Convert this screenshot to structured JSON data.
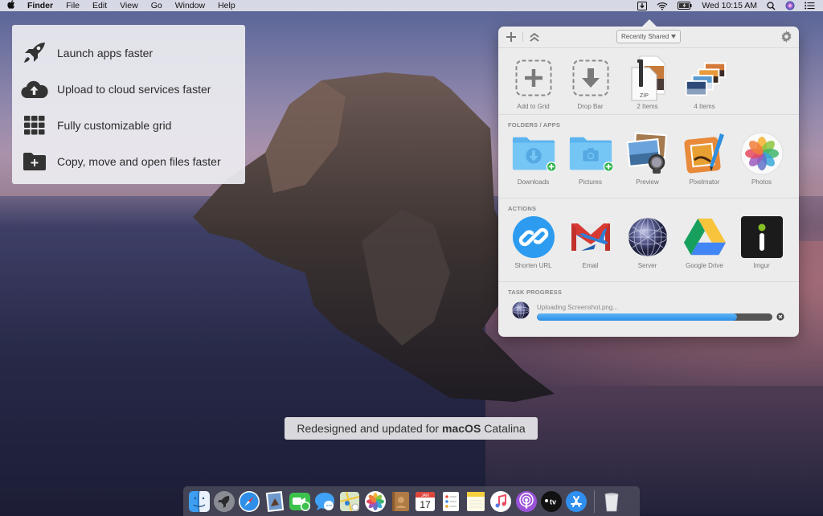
{
  "menubar": {
    "app_name": "Finder",
    "menus": [
      "File",
      "Edit",
      "View",
      "Go",
      "Window",
      "Help"
    ],
    "status_icons": [
      "dropzone-icon",
      "wifi-icon",
      "battery-icon"
    ],
    "clock": "Wed 10:15 AM",
    "extra_icons": [
      "spotlight-icon",
      "siri-icon",
      "notification-center-icon"
    ]
  },
  "features": [
    {
      "icon": "rocket-icon",
      "text": "Launch apps faster"
    },
    {
      "icon": "cloud-upload-icon",
      "text": "Upload to cloud services faster"
    },
    {
      "icon": "grid-icon",
      "text": "Fully customizable grid"
    },
    {
      "icon": "folder-plus-icon",
      "text": "Copy, move and open files faster"
    }
  ],
  "popover": {
    "dropdown_label": "Recently Shared",
    "top_items": [
      {
        "label": "Add to Grid",
        "icon": "add-to-grid-icon"
      },
      {
        "label": "Drop Bar",
        "icon": "drop-bar-icon"
      },
      {
        "label": "2 Items",
        "icon": "zip-stack-icon"
      },
      {
        "label": "4 Items",
        "icon": "photo-stack-icon"
      }
    ],
    "folders_title": "FOLDERS / APPS",
    "folders": [
      {
        "label": "Downloads",
        "icon": "downloads-folder-icon"
      },
      {
        "label": "Pictures",
        "icon": "pictures-folder-icon"
      },
      {
        "label": "Preview",
        "icon": "preview-app-icon"
      },
      {
        "label": "Pixelmator",
        "icon": "pixelmator-app-icon"
      },
      {
        "label": "Photos",
        "icon": "photos-app-icon"
      }
    ],
    "actions_title": "ACTIONS",
    "actions": [
      {
        "label": "Shorten URL",
        "icon": "link-icon"
      },
      {
        "label": "Email",
        "icon": "email-icon"
      },
      {
        "label": "Server",
        "icon": "server-globe-icon"
      },
      {
        "label": "Google Drive",
        "icon": "google-drive-icon"
      },
      {
        "label": "Imgur",
        "icon": "imgur-icon"
      }
    ],
    "progress_title": "TASK PROGRESS",
    "task": {
      "text": "Uploading Screenshot.png...",
      "progress_percent": 85
    },
    "colors": {
      "progress_fill": "#2b8ee6",
      "progress_track": "#555555",
      "folder_blue": "#6cc0f3",
      "badge_green": "#2db34a"
    }
  },
  "caption": {
    "prefix": "Redesigned and updated for",
    "bold": "macOS",
    "suffix": "Catalina"
  },
  "dock": {
    "apps": [
      "Finder",
      "Launchpad",
      "Safari",
      "Mail",
      "FaceTime",
      "Messages",
      "Maps",
      "Photos",
      "Contacts",
      "Calendar",
      "Reminders",
      "Notes",
      "Music",
      "Podcasts",
      "TV",
      "App Store"
    ],
    "calendar_month": "JAN",
    "calendar_day": "17",
    "tv_label": "tv",
    "trash": "Trash"
  }
}
